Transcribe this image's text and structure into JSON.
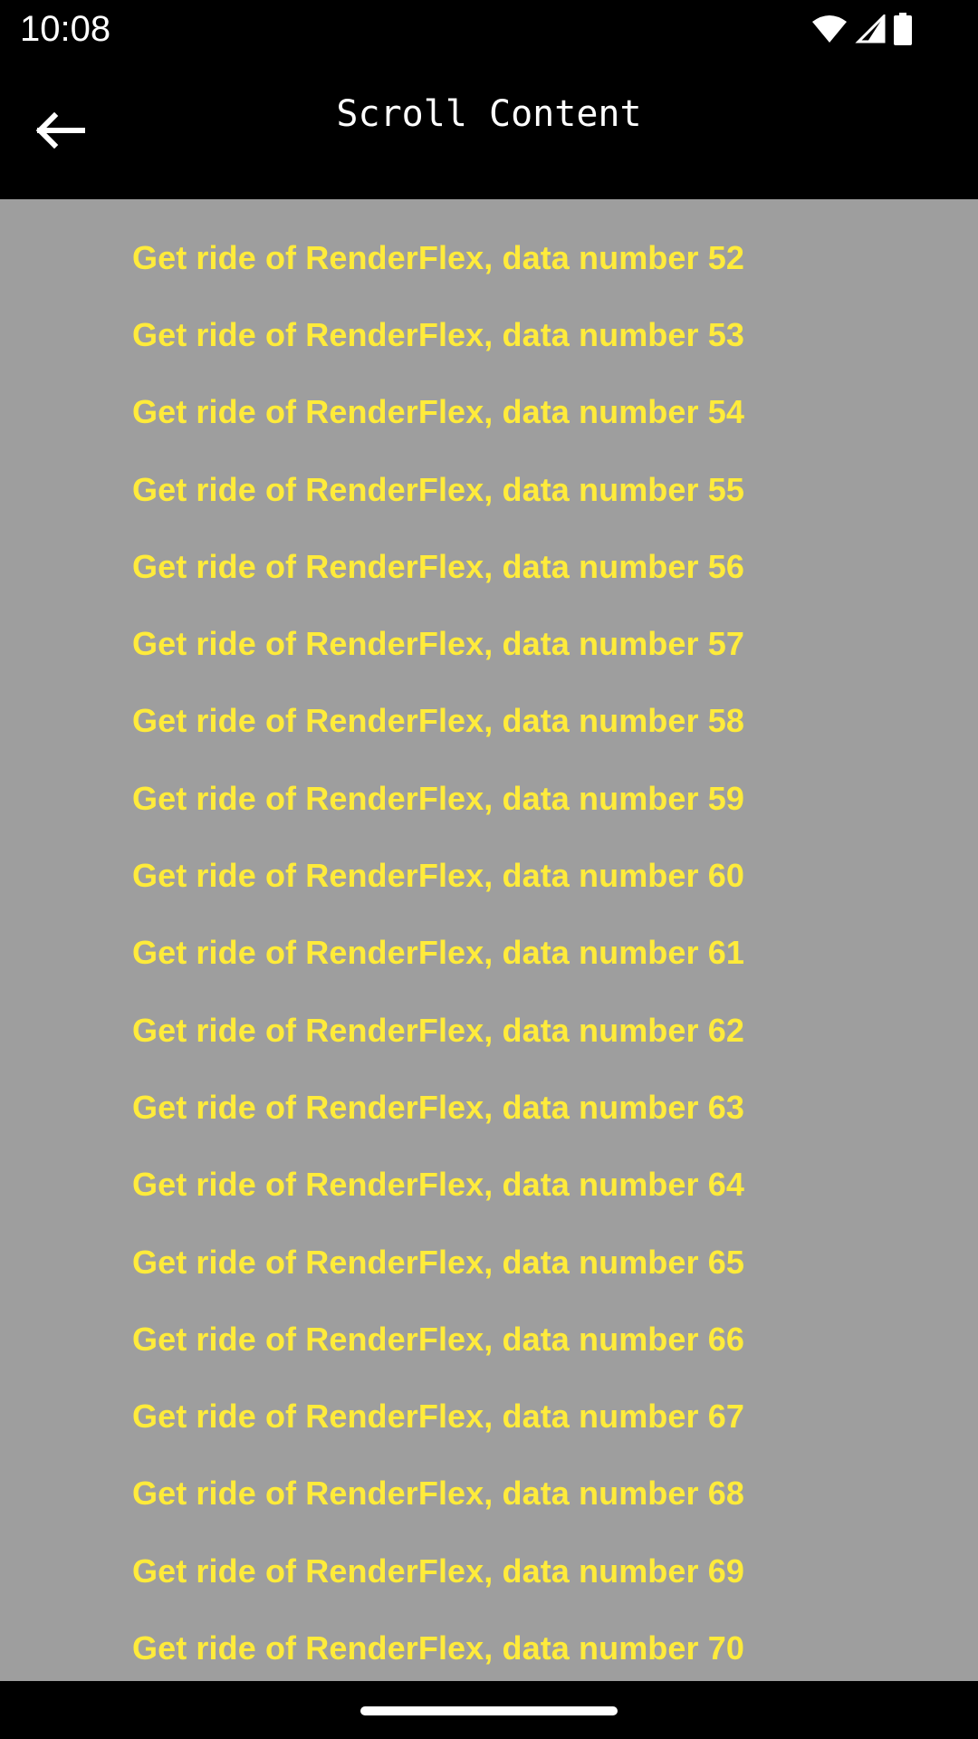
{
  "status_bar": {
    "time": "10:08",
    "icons": [
      "wifi-icon",
      "cellular-signal-icon",
      "battery-icon"
    ]
  },
  "app_bar": {
    "back_icon": "arrow-back-icon",
    "title": "Scroll Content"
  },
  "list": {
    "items": [
      "Get ride of RenderFlex, data number 52",
      "Get ride of RenderFlex, data number 53",
      "Get ride of RenderFlex, data number 54",
      "Get ride of RenderFlex, data number 55",
      "Get ride of RenderFlex, data number 56",
      "Get ride of RenderFlex, data number 57",
      "Get ride of RenderFlex, data number 58",
      "Get ride of RenderFlex, data number 59",
      "Get ride of RenderFlex, data number 60",
      "Get ride of RenderFlex, data number 61",
      "Get ride of RenderFlex, data number 62",
      "Get ride of RenderFlex, data number 63",
      "Get ride of RenderFlex, data number 64",
      "Get ride of RenderFlex, data number 65",
      "Get ride of RenderFlex, data number 66",
      "Get ride of RenderFlex, data number 67",
      "Get ride of RenderFlex, data number 68",
      "Get ride of RenderFlex, data number 69",
      "Get ride of RenderFlex, data number 70"
    ]
  },
  "colors": {
    "background": "#9e9e9e",
    "text": "#ffeb3b",
    "bars": "#000000"
  }
}
